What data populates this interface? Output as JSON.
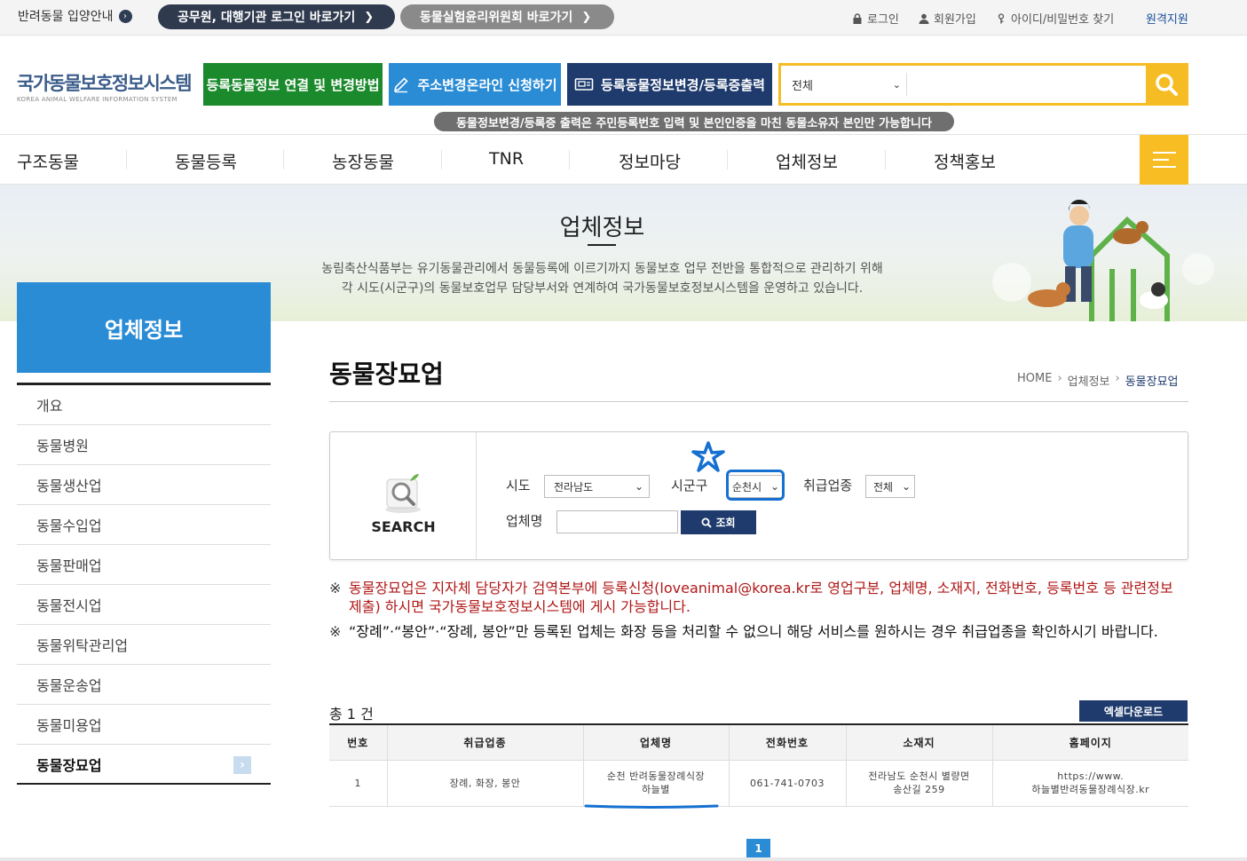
{
  "utilbar": {
    "pet_guide": "반려동물 입양안내",
    "btn_official": "공무원, 대행기관 로그인 바로가기",
    "btn_ethics": "동물실험윤리위원회 바로가기",
    "login": "로그인",
    "join": "회원가입",
    "find": "아이디/비밀번호 찾기",
    "remote": "원격지원"
  },
  "header": {
    "logo_kr": "국가동물보호정보시스템",
    "logo_en": "KOREA ANIMAL WELFARE INFORMATION SYSTEM",
    "btn_link": "등록동물정보 연결 및 변경방법",
    "btn_address": "주소변경온라인 신청하기",
    "btn_print": "등록동물정보변경/등록증출력",
    "search_scope": "전체",
    "notice": "동물정보변경/등록증 출력은 주민등록번호 입력 및 본인인증을 마친 동물소유자 본인만 가능합니다"
  },
  "nav": {
    "items": [
      "구조동물",
      "동물등록",
      "농장동물",
      "TNR",
      "정보마당",
      "업체정보",
      "정책홍보"
    ]
  },
  "hero": {
    "title": "업체정보",
    "desc1": "농림축산식품부는 유기동물관리에서 동물등록에 이르기까지 동물보호 업무 전반을 통합적으로 관리하기 위해",
    "desc2": "각 시도(시군구)의 동물보호업무 담당부서와 연계하여 국가동물보호정보시스템을 운영하고 있습니다."
  },
  "sidebar": {
    "title": "업체정보",
    "items": [
      {
        "label": "개요"
      },
      {
        "label": "동물병원"
      },
      {
        "label": "동물생산업"
      },
      {
        "label": "동물수입업"
      },
      {
        "label": "동물판매업"
      },
      {
        "label": "동물전시업"
      },
      {
        "label": "동물위탁관리업"
      },
      {
        "label": "동물운송업"
      },
      {
        "label": "동물미용업"
      },
      {
        "label": "동물장묘업"
      }
    ],
    "active_index": 9
  },
  "content": {
    "page_title": "동물장묘업",
    "breadcrumb": [
      "HOME",
      "업체정보",
      "동물장묘업"
    ],
    "search": {
      "panel_label": "SEARCH",
      "sido_label": "시도",
      "sido_value": "전라남도",
      "sigungu_label": "시군구",
      "sigungu_value": "순천시",
      "type_label": "취급업종",
      "type_value": "전체",
      "name_label": "업체명",
      "name_value": "",
      "submit": "조회"
    },
    "notes": [
      {
        "mark": "※",
        "text": "동물장묘업은 지자체 담당자가 검역본부에 등록신청(loveanimal@korea.kr로 영업구분, 업체명, 소재지, 전화번호, 등록번호 등 관련정보 제출) 하시면 국가동물보호정보시스템에 게시 가능합니다."
      },
      {
        "mark": "※",
        "text": "“장례”·“봉안”·“장례, 봉안”만 등록된 업체는 화장 등을 처리할 수 없으니 해당 서비스를 원하시는 경우 취급업종을 확인하시기 바랍니다."
      }
    ],
    "total": "총 1 건",
    "excel": "엑셀다운로드",
    "table": {
      "headers": [
        "번호",
        "취급업종",
        "업체명",
        "전화번호",
        "소재지",
        "홈페이지"
      ],
      "rows": [
        {
          "no": "1",
          "type": "장례, 화장, 봉안",
          "name_line1": "순천 반려동물장례식장",
          "name_line2": "하늘별",
          "phone": "061-741-0703",
          "addr_line1": "전라남도 순천시 별량면",
          "addr_line2": "송산길 259",
          "home_line1": "https://www.",
          "home_line2": "하늘별반려동물장례식장.kr"
        }
      ]
    },
    "page": "1"
  },
  "colors": {
    "navy": "#1f3b6d",
    "blue": "#2b8cd6",
    "green": "#1b8a2c",
    "yellow": "#f5bd23",
    "red_note": "#b01818",
    "annotation": "#1670d1"
  }
}
